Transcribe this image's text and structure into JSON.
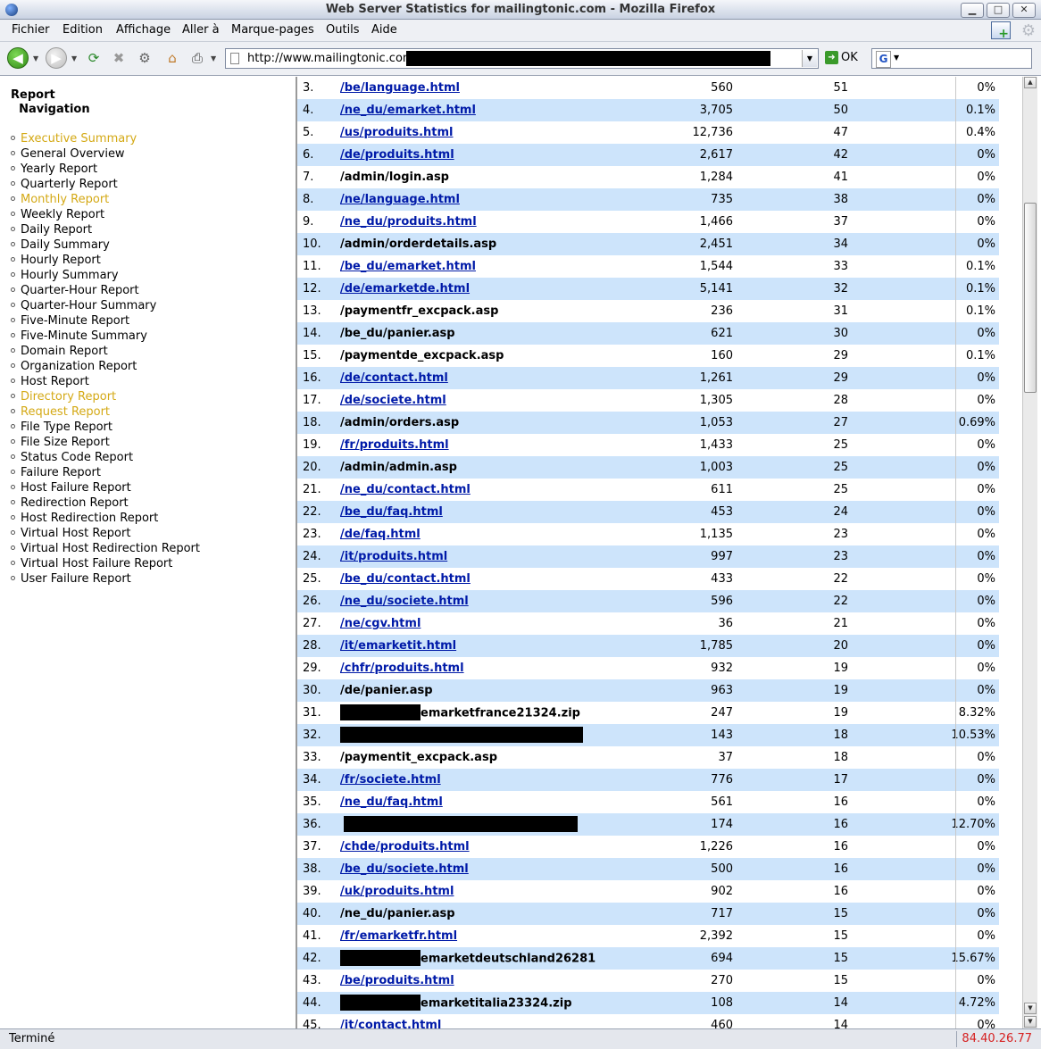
{
  "window": {
    "title": "Web Server Statistics for mailingtonic.com - Mozilla Firefox"
  },
  "menu": {
    "items": [
      "Fichier",
      "Edition",
      "Affichage",
      "Aller à",
      "Marque-pages",
      "Outils",
      "Aide"
    ]
  },
  "toolbar": {
    "url": "http://www.mailingtonic.com/",
    "go_label": "OK"
  },
  "sidebar": {
    "heading_line1": "Report",
    "heading_line2": "Navigation",
    "items": [
      {
        "label": "Executive Summary",
        "active": true
      },
      {
        "label": "General Overview",
        "active": false
      },
      {
        "label": "Yearly Report",
        "active": false
      },
      {
        "label": "Quarterly Report",
        "active": false
      },
      {
        "label": "Monthly Report",
        "active": true
      },
      {
        "label": "Weekly Report",
        "active": false
      },
      {
        "label": "Daily Report",
        "active": false
      },
      {
        "label": "Daily Summary",
        "active": false
      },
      {
        "label": "Hourly Report",
        "active": false
      },
      {
        "label": "Hourly Summary",
        "active": false
      },
      {
        "label": "Quarter-Hour Report",
        "active": false
      },
      {
        "label": "Quarter-Hour Summary",
        "active": false
      },
      {
        "label": "Five-Minute Report",
        "active": false
      },
      {
        "label": "Five-Minute Summary",
        "active": false
      },
      {
        "label": "Domain Report",
        "active": false
      },
      {
        "label": "Organization Report",
        "active": false
      },
      {
        "label": "Host Report",
        "active": false
      },
      {
        "label": "Directory Report",
        "active": true
      },
      {
        "label": "Request Report",
        "active": true
      },
      {
        "label": "File Type Report",
        "active": false
      },
      {
        "label": "File Size Report",
        "active": false
      },
      {
        "label": "Status Code Report",
        "active": false
      },
      {
        "label": "Failure Report",
        "active": false
      },
      {
        "label": "Host Failure Report",
        "active": false
      },
      {
        "label": "Redirection Report",
        "active": false
      },
      {
        "label": "Host Redirection Report",
        "active": false
      },
      {
        "label": "Virtual Host Report",
        "active": false
      },
      {
        "label": "Virtual Host Redirection Report",
        "active": false
      },
      {
        "label": "Virtual Host Failure Report",
        "active": false
      },
      {
        "label": "User Failure Report",
        "active": false
      }
    ]
  },
  "table": {
    "rows": [
      {
        "n": "3.",
        "path": "/be/language.html",
        "link": true,
        "c1": "560",
        "c2": "51",
        "c3": "0%"
      },
      {
        "n": "4.",
        "path": "/ne_du/emarket.html",
        "link": true,
        "c1": "3,705",
        "c2": "50",
        "c3": "0.1%"
      },
      {
        "n": "5.",
        "path": "/us/produits.html",
        "link": true,
        "c1": "12,736",
        "c2": "47",
        "c3": "0.4%"
      },
      {
        "n": "6.",
        "path": "/de/produits.html",
        "link": true,
        "c1": "2,617",
        "c2": "42",
        "c3": "0%"
      },
      {
        "n": "7.",
        "path": "/admin/login.asp",
        "link": false,
        "c1": "1,284",
        "c2": "41",
        "c3": "0%"
      },
      {
        "n": "8.",
        "path": "/ne/language.html",
        "link": true,
        "c1": "735",
        "c2": "38",
        "c3": "0%"
      },
      {
        "n": "9.",
        "path": "/ne_du/produits.html",
        "link": true,
        "c1": "1,466",
        "c2": "37",
        "c3": "0%"
      },
      {
        "n": "10.",
        "path": "/admin/orderdetails.asp",
        "link": false,
        "c1": "2,451",
        "c2": "34",
        "c3": "0%"
      },
      {
        "n": "11.",
        "path": "/be_du/emarket.html",
        "link": true,
        "c1": "1,544",
        "c2": "33",
        "c3": "0.1%"
      },
      {
        "n": "12.",
        "path": "/de/emarketde.html",
        "link": true,
        "c1": "5,141",
        "c2": "32",
        "c3": "0.1%"
      },
      {
        "n": "13.",
        "path": "/paymentfr_excpack.asp",
        "link": false,
        "c1": "236",
        "c2": "31",
        "c3": "0.1%"
      },
      {
        "n": "14.",
        "path": "/be_du/panier.asp",
        "link": false,
        "c1": "621",
        "c2": "30",
        "c3": "0%"
      },
      {
        "n": "15.",
        "path": "/paymentde_excpack.asp",
        "link": false,
        "c1": "160",
        "c2": "29",
        "c3": "0.1%"
      },
      {
        "n": "16.",
        "path": "/de/contact.html",
        "link": true,
        "c1": "1,261",
        "c2": "29",
        "c3": "0%"
      },
      {
        "n": "17.",
        "path": "/de/societe.html",
        "link": true,
        "c1": "1,305",
        "c2": "28",
        "c3": "0%"
      },
      {
        "n": "18.",
        "path": "/admin/orders.asp",
        "link": false,
        "c1": "1,053",
        "c2": "27",
        "c3": "0.69%"
      },
      {
        "n": "19.",
        "path": "/fr/produits.html",
        "link": true,
        "c1": "1,433",
        "c2": "25",
        "c3": "0%"
      },
      {
        "n": "20.",
        "path": "/admin/admin.asp",
        "link": false,
        "c1": "1,003",
        "c2": "25",
        "c3": "0%"
      },
      {
        "n": "21.",
        "path": "/ne_du/contact.html",
        "link": true,
        "c1": "611",
        "c2": "25",
        "c3": "0%"
      },
      {
        "n": "22.",
        "path": "/be_du/faq.html",
        "link": true,
        "c1": "453",
        "c2": "24",
        "c3": "0%"
      },
      {
        "n": "23.",
        "path": "/de/faq.html",
        "link": true,
        "c1": "1,135",
        "c2": "23",
        "c3": "0%"
      },
      {
        "n": "24.",
        "path": "/it/produits.html",
        "link": true,
        "c1": "997",
        "c2": "23",
        "c3": "0%"
      },
      {
        "n": "25.",
        "path": "/be_du/contact.html",
        "link": true,
        "c1": "433",
        "c2": "22",
        "c3": "0%"
      },
      {
        "n": "26.",
        "path": "/ne_du/societe.html",
        "link": true,
        "c1": "596",
        "c2": "22",
        "c3": "0%"
      },
      {
        "n": "27.",
        "path": "/ne/cgv.html",
        "link": true,
        "c1": "36",
        "c2": "21",
        "c3": "0%"
      },
      {
        "n": "28.",
        "path": "/it/emarketit.html",
        "link": true,
        "c1": "1,785",
        "c2": "20",
        "c3": "0%"
      },
      {
        "n": "29.",
        "path": "/chfr/produits.html",
        "link": true,
        "c1": "932",
        "c2": "19",
        "c3": "0%"
      },
      {
        "n": "30.",
        "path": "/de/panier.asp",
        "link": false,
        "c1": "963",
        "c2": "19",
        "c3": "0%"
      },
      {
        "n": "31.",
        "path": "emarketfrance21324.zip",
        "link": false,
        "redact": "prefix",
        "c1": "247",
        "c2": "19",
        "c3": "8.32%"
      },
      {
        "n": "32.",
        "path": "",
        "link": false,
        "redact": "full",
        "c1": "143",
        "c2": "18",
        "c3": "10.53%"
      },
      {
        "n": "33.",
        "path": "/paymentit_excpack.asp",
        "link": false,
        "c1": "37",
        "c2": "18",
        "c3": "0%"
      },
      {
        "n": "34.",
        "path": "/fr/societe.html",
        "link": true,
        "c1": "776",
        "c2": "17",
        "c3": "0%"
      },
      {
        "n": "35.",
        "path": "/ne_du/faq.html",
        "link": true,
        "c1": "561",
        "c2": "16",
        "c3": "0%"
      },
      {
        "n": "36.",
        "path": "",
        "link": false,
        "redact": "full",
        "c1": "174",
        "c2": "16",
        "c3": "12.70%"
      },
      {
        "n": "37.",
        "path": "/chde/produits.html",
        "link": true,
        "c1": "1,226",
        "c2": "16",
        "c3": "0%"
      },
      {
        "n": "38.",
        "path": "/be_du/societe.html",
        "link": true,
        "c1": "500",
        "c2": "16",
        "c3": "0%"
      },
      {
        "n": "39.",
        "path": "/uk/produits.html",
        "link": true,
        "c1": "902",
        "c2": "16",
        "c3": "0%"
      },
      {
        "n": "40.",
        "path": "/ne_du/panier.asp",
        "link": false,
        "c1": "717",
        "c2": "15",
        "c3": "0%"
      },
      {
        "n": "41.",
        "path": "/fr/emarketfr.html",
        "link": true,
        "c1": "2,392",
        "c2": "15",
        "c3": "0%"
      },
      {
        "n": "42.",
        "path": "emarketdeutschland26281.zip",
        "link": false,
        "redact": "prefix",
        "c1": "694",
        "c2": "15",
        "c3": "15.67%"
      },
      {
        "n": "43.",
        "path": "/be/produits.html",
        "link": true,
        "c1": "270",
        "c2": "15",
        "c3": "0%"
      },
      {
        "n": "44.",
        "path": "emarketitalia23324.zip",
        "link": false,
        "redact": "prefix",
        "c1": "108",
        "c2": "14",
        "c3": "4.72%"
      },
      {
        "n": "45.",
        "path": "/it/contact.html",
        "link": true,
        "c1": "460",
        "c2": "14",
        "c3": "0%"
      }
    ]
  },
  "status": {
    "left": "Terminé",
    "right": "84.40.26.77"
  },
  "colors": {
    "row_shade": "#cde4fb",
    "link": "#001aa8",
    "active_nav": "#d4a915",
    "status_ip": "#d62020"
  }
}
